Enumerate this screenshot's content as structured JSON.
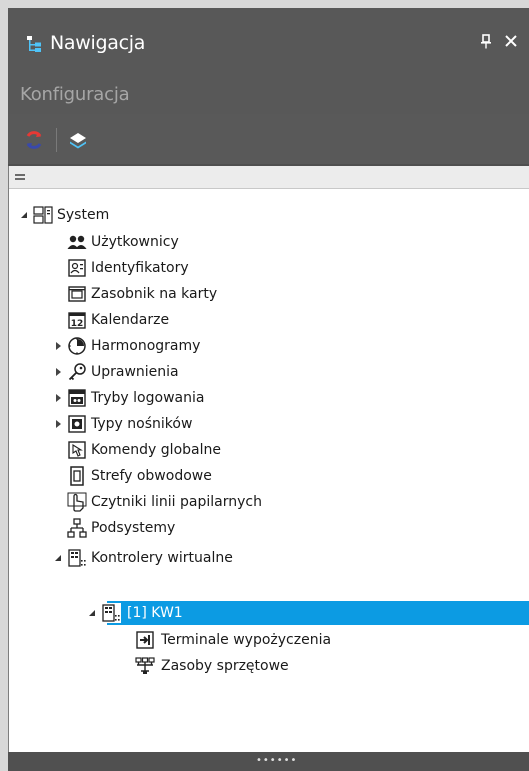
{
  "window": {
    "title": "Nawigacja",
    "pin_glyph": "❙",
    "close_glyph": "×"
  },
  "subheader": {
    "title": "Konfiguracja"
  },
  "toolbar": {
    "buttons": [
      {
        "icon": "refresh-icon"
      },
      {
        "icon": "layers-icon"
      }
    ]
  },
  "footer": {
    "grip": "••••••"
  },
  "colors": {
    "selection": "#0c9be3",
    "panel": "#585858",
    "tree_background": "#ffffff"
  },
  "tree": [
    {
      "label": "System",
      "icon": "system-icon",
      "expander": "expanded"
    },
    {
      "label": "Użytkownicy",
      "icon": "users-icon",
      "expander": "none"
    },
    {
      "label": "Identyfikatory",
      "icon": "id-card-icon",
      "expander": "none"
    },
    {
      "label": "Zasobnik na karty",
      "icon": "card-tray-icon",
      "expander": "none"
    },
    {
      "label": "Kalendarze",
      "icon": "calendar-icon",
      "expander": "none"
    },
    {
      "label": "Harmonogramy",
      "icon": "clock-icon",
      "expander": "collapsed"
    },
    {
      "label": "Uprawnienia",
      "icon": "key-icon",
      "expander": "collapsed"
    },
    {
      "label": "Tryby logowania",
      "icon": "login-mode-icon",
      "expander": "collapsed"
    },
    {
      "label": "Typy nośników",
      "icon": "media-type-icon",
      "expander": "collapsed"
    },
    {
      "label": "Komendy globalne",
      "icon": "global-command-icon",
      "expander": "none"
    },
    {
      "label": "Strefy obwodowe",
      "icon": "zone-icon",
      "expander": "none"
    },
    {
      "label": "Czytniki linii papilarnych",
      "icon": "fingerprint-reader-icon",
      "expander": "none"
    },
    {
      "label": "Podsystemy",
      "icon": "subsystem-icon",
      "expander": "none"
    },
    {
      "label": "Kontrolery wirtualne",
      "icon": "virtual-controller-icon",
      "expander": "expanded"
    },
    {
      "label": "[1] KW1",
      "icon": "controller-icon",
      "expander": "expanded",
      "selected": true
    },
    {
      "label": "Terminale wypożyczenia",
      "icon": "terminal-icon",
      "expander": "none"
    },
    {
      "label": "Zasoby sprzętowe",
      "icon": "hardware-icon",
      "expander": "none"
    }
  ]
}
